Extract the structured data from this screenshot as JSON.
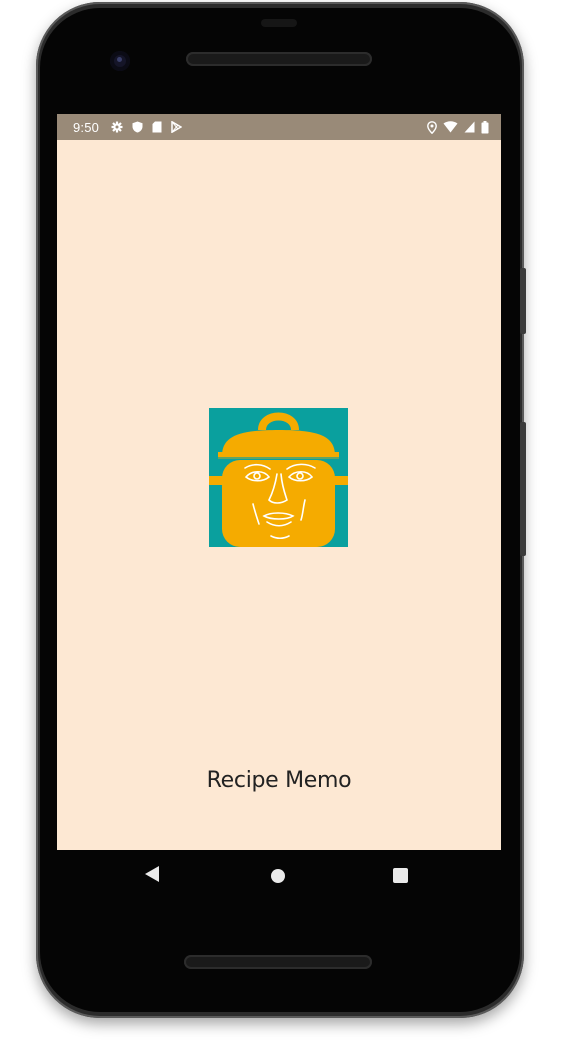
{
  "status_bar": {
    "time": "9:50",
    "left_icons": [
      "gear-icon",
      "shield-icon",
      "sd-card-icon",
      "play-store-icon"
    ],
    "right_icons": [
      "location-icon",
      "wifi-icon",
      "signal-icon",
      "battery-icon"
    ]
  },
  "splash": {
    "app_name": "Recipe Memo",
    "logo": "pot-face-logo"
  },
  "navigation": {
    "buttons": [
      "back-icon",
      "home-icon",
      "recents-icon"
    ]
  },
  "colors": {
    "screen_background": "#fde8d3",
    "status_bar": "#998a78",
    "logo_background": "#0aa09e",
    "logo_pot": "#f5ab00"
  }
}
